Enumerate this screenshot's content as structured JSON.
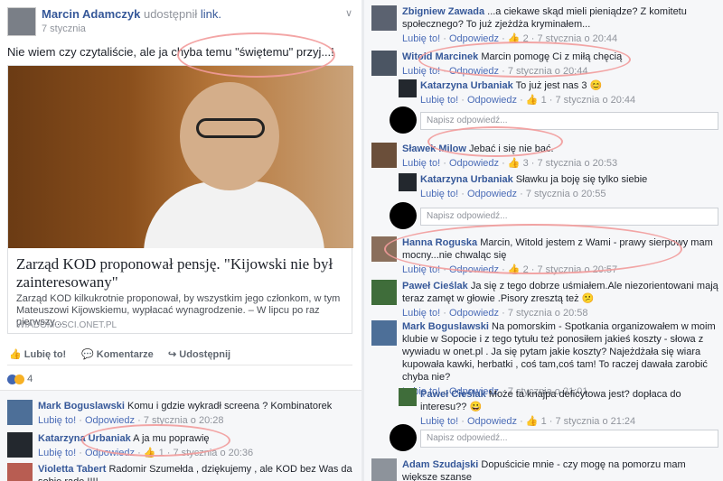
{
  "post": {
    "author": "Marcin Adamczyk",
    "action": "udostępnił",
    "link_word": "link.",
    "date": "7 stycznia",
    "text": "Nie wiem czy czytaliście, ale ja chyba temu \"świętemu\" przyj...!",
    "link_title": "Zarząd KOD proponował pensję. \"Kijowski nie był zainteresowany\"",
    "link_desc": "Zarząd KOD kilkukrotnie proponował, by wszystkim jego członkom, w tym Mateuszowi Kijowskiemu, wypłacać wynagrodzenie. – W lipcu po raz pierwszy....",
    "link_source": "WIADOMOSCI.ONET.PL",
    "like_label": "Lubię to!",
    "comment_label": "Komentarze",
    "share_label": "Udostępnij",
    "reaction_count": "4",
    "chevron": "∨"
  },
  "left_comments": [
    {
      "name": "Mark Boguslawski",
      "text": "Komu i gdzie wykradł screena ? Kombinatorek",
      "like": "Lubię to!",
      "reply": "Odpowiedz",
      "time": "7 stycznia o 20:28"
    },
    {
      "name": "Katarzyna Urbaniak",
      "text": "A ja mu poprawię",
      "like": "Lubię to!",
      "reply": "Odpowiedz",
      "count": "1",
      "time": "7 stycznia o 20:36"
    },
    {
      "name": "Violetta Tabert",
      "text": "Radomir Szumełda , dziękujemy , ale KOD bez Was da sobie radę !!!!"
    }
  ],
  "right_comments": [
    {
      "name": "Zbigniew Zawada",
      "text": "...a ciekawe skąd mieli pieniądze? Z komitetu społecznego? To już zjeżdża kryminałem...",
      "like": "Lubię to!",
      "reply": "Odpowiedz",
      "count": "2",
      "time": "7 stycznia o 20:44"
    },
    {
      "name": "Witold Marcinek",
      "text": "Marcin pomogę Ci z miłą chęcią",
      "like": "Lubię to!",
      "reply": "Odpowiedz",
      "time": "7 stycznia o 20:44"
    },
    {
      "name": "Katarzyna Urbaniak",
      "text": "To już jest nas 3",
      "like": "Lubię to!",
      "reply": "Odpowiedz",
      "count": "1",
      "time": "7 stycznia o 20:44"
    },
    {
      "name": "Sławek Milow",
      "text": "Jebać i się nie bać.",
      "like": "Lubię to!",
      "reply": "Odpowiedz",
      "count": "3",
      "time": "7 stycznia o 20:53"
    },
    {
      "name": "Katarzyna Urbaniak",
      "text": "Sławku ja boję się tylko siebie",
      "like": "Lubię to!",
      "reply": "Odpowiedz",
      "time": "7 stycznia o 20:55"
    },
    {
      "name": "Hanna Roguska",
      "text": "Marcin, Witold jestem z Wami - prawy sierpowy mam mocny...nie chwaląc się",
      "like": "Lubię to!",
      "reply": "Odpowiedz",
      "count": "2",
      "time": "7 stycznia o 20:57"
    },
    {
      "name": "Paweł Cieślak",
      "text": "Ja się z tego dobrze uśmiałem.Ale niezorientowani mają teraz zamęt w głowie .Pisory zresztą też",
      "like": "Lubię to!",
      "reply": "Odpowiedz",
      "time": "7 stycznia o 20:58"
    },
    {
      "name": "Mark Boguslawski",
      "text": "Na pomorskim - Spotkania organizowałem w moim klubie w Sopocie i z tego tytułu też ponosiłem jakieś koszty - słowa z wywiadu w onet.pl . Ja się pytam jakie koszty? Najeżdżała się wiara kupowała kawki, herbatki , coś tam,coś tam! To raczej dawała zarobić chyba nie?",
      "like": "Lubię to!",
      "reply": "Odpowiedz",
      "time": "7 stycznia o 21:01"
    },
    {
      "name": "Paweł Cieślak",
      "text": "Może ta knajpa deficytowa jest? dopłaca do interesu??",
      "like": "Lubię to!",
      "reply": "Odpowiedz",
      "count": "1",
      "time": "7 stycznia o 21:24"
    },
    {
      "name": "Adam Szudajski",
      "text": "Dopuścicie mnie - czy mogę na pomorzu mam większe szanse"
    }
  ],
  "reply_placeholder": "Napisz odpowiedź..."
}
